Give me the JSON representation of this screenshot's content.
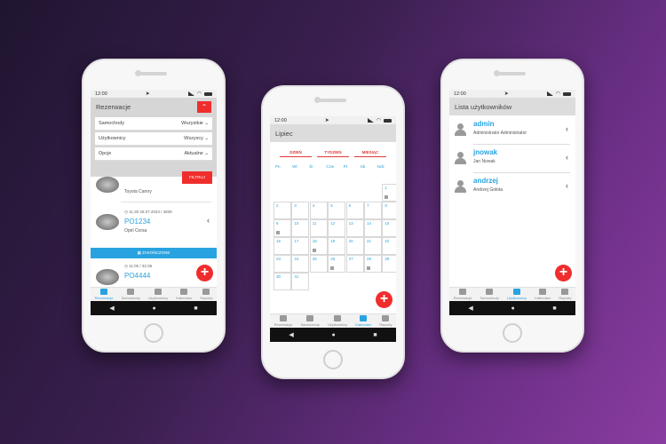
{
  "status_time": "12:00",
  "tabs": [
    "Rezerwacje",
    "Samochody",
    "Użytkownicy",
    "Kalendarz",
    "Raporty"
  ],
  "nav": {
    "back": "◀",
    "home": "●",
    "recent": "■"
  },
  "fab_label": "+",
  "colors": {
    "accent": "#29a3e0",
    "red": "#f02d2d",
    "bg_start": "#1f1530",
    "bg_end": "#8a3ca0"
  },
  "reservations": {
    "title": "Rezerwacje",
    "filters": [
      {
        "label": "Samochody",
        "value": "Wszystkie"
      },
      {
        "label": "Użytkownicy",
        "value": "Wszyscy"
      },
      {
        "label": "Opcje",
        "value": "Aktualne"
      }
    ],
    "filter_button": "FILTRUJ",
    "items": [
      {
        "code": "",
        "name": "Toyota Camry",
        "time": ""
      },
      {
        "code": "PO1234",
        "name": "Opel Corsa",
        "time": "11:30 26.07.2023 / 4839"
      },
      {
        "code": "PO4444",
        "name": "",
        "time": "11:00 / 32:35"
      }
    ],
    "blue_bar": "ZAKOŃCZONE"
  },
  "calendar": {
    "month": "Lipiec",
    "segments": [
      "DZIEŃ",
      "TYDZIEŃ",
      "MIESIĄC"
    ],
    "weekdays": [
      "Pn",
      "Wt",
      "Śr",
      "Czw",
      "Pt",
      "Sb",
      "Ndz"
    ],
    "days": [
      "1",
      "2",
      "3",
      "4",
      "5",
      "6",
      "7",
      "8",
      "9",
      "10",
      "11",
      "12",
      "13",
      "14",
      "15",
      "16",
      "17",
      "18",
      "19",
      "20",
      "21",
      "22",
      "23",
      "24",
      "25",
      "26",
      "27",
      "28",
      "29",
      "30",
      "31"
    ]
  },
  "users": {
    "title": "Lista użytkowników",
    "list": [
      {
        "username": "admin",
        "fullname": "Administrator Administrator"
      },
      {
        "username": "jnowak",
        "fullname": "Jan Nowak"
      },
      {
        "username": "andrzej",
        "fullname": "Andrzej Gołota"
      }
    ]
  }
}
